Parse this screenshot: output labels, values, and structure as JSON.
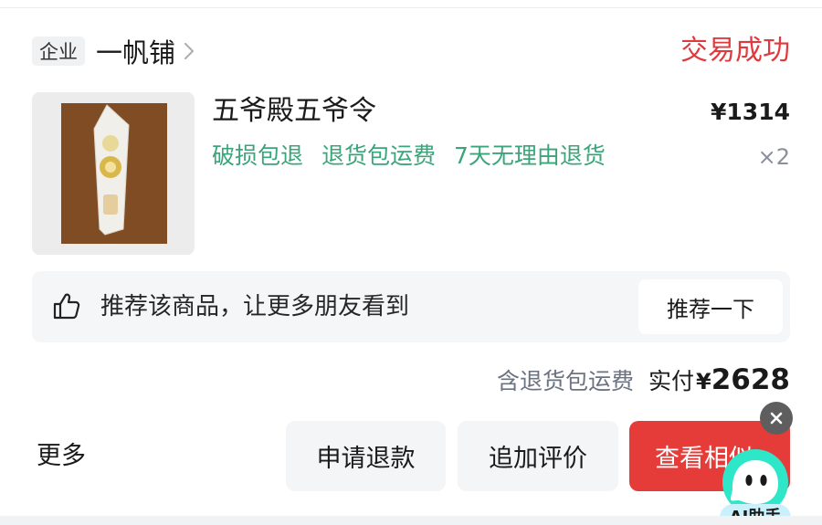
{
  "shop": {
    "tag": "企业",
    "name": "一帆铺",
    "status": "交易成功"
  },
  "product": {
    "title": "五爷殿五爷令",
    "price": "¥1314",
    "quantity": "×2",
    "tags": [
      "破损包退",
      "退货包运费",
      "7天无理由退货"
    ],
    "image_icon": "product-photo"
  },
  "recommend": {
    "icon": "thumbs-up-icon",
    "text": "推荐该商品，让更多朋友看到",
    "button": "推荐一下"
  },
  "payment": {
    "note": "含退货包运费",
    "label": "实付",
    "currency": "¥",
    "amount": "2628"
  },
  "actions": {
    "more": "更多",
    "refund": "申请退款",
    "review": "追加评价",
    "view_similar": "查看相似"
  },
  "assistant": {
    "label": "AI助手",
    "close_icon": "close-icon"
  },
  "colors": {
    "status_red": "#e0393e",
    "tag_green": "#3aa57a",
    "primary_button": "#e53c3a"
  }
}
